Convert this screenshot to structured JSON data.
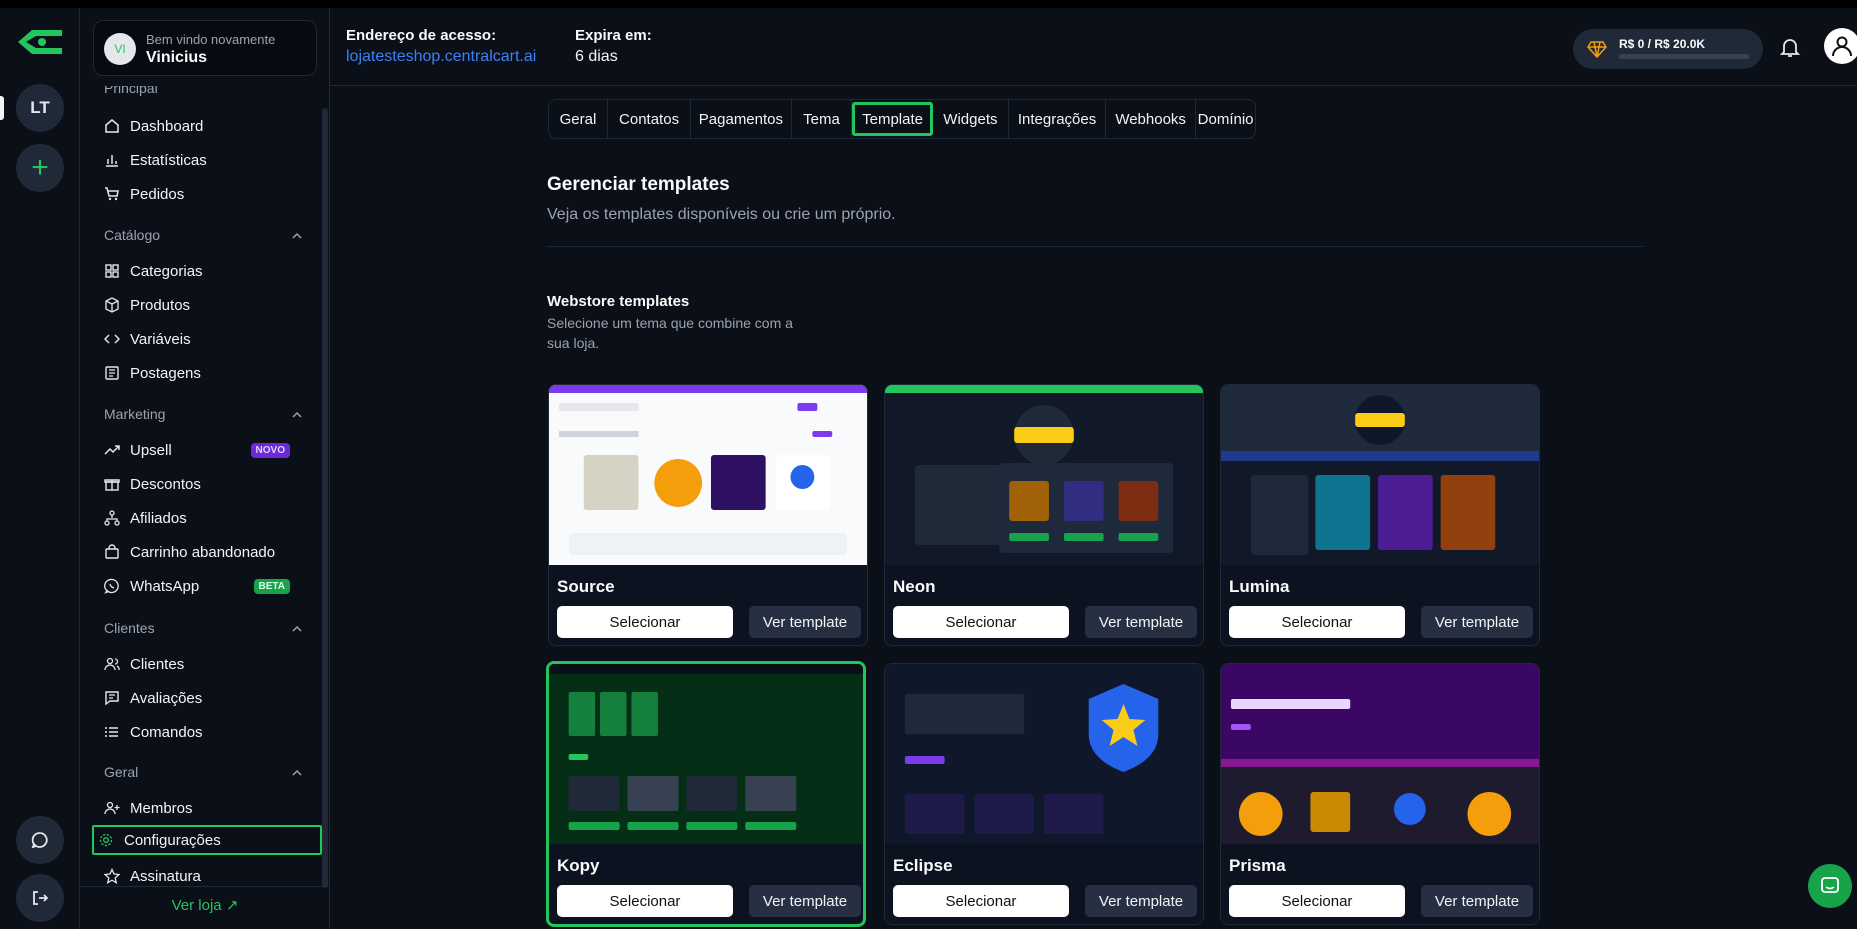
{
  "rail": {
    "store_initials": "LT"
  },
  "user": {
    "initials": "VI",
    "greeting": "Bem vindo novamente",
    "name": "Vinicius"
  },
  "header": {
    "address_label": "Endereço de acesso:",
    "address_value": "lojatesteshop.centralcart.ai",
    "expires_label": "Expira em:",
    "expires_value": "6 dias",
    "credit_text": "R$ 0 / R$ 20.0K",
    "credit_progress": 0
  },
  "sidebar": {
    "cut_group": "Principal",
    "main": [
      "Dashboard",
      "Estatísticas",
      "Pedidos"
    ],
    "catalog": {
      "title": "Catálogo",
      "items": [
        "Categorias",
        "Produtos",
        "Variáveis",
        "Postagens"
      ]
    },
    "marketing": {
      "title": "Marketing",
      "items": [
        "Upsell",
        "Descontos",
        "Afiliados",
        "Carrinho abandonado",
        "WhatsApp"
      ],
      "badge_novo": "NOVO",
      "badge_beta": "BETA"
    },
    "clients": {
      "title": "Clientes",
      "items": [
        "Clientes",
        "Avaliações",
        "Comandos"
      ]
    },
    "general": {
      "title": "Geral",
      "items": [
        "Membros",
        "Configurações",
        "Assinatura"
      ]
    },
    "view_store": "Ver loja"
  },
  "tabs": [
    "Geral",
    "Contatos",
    "Pagamentos",
    "Tema",
    "Template",
    "Widgets",
    "Integrações",
    "Webhooks",
    "Domínio"
  ],
  "active_tab": "Template",
  "section": {
    "title": "Gerenciar templates",
    "subtitle": "Veja os templates disponíveis ou crie um próprio.",
    "webstore_title": "Webstore templates",
    "webstore_subtitle": "Selecione um tema que combine com a sua loja."
  },
  "buttons": {
    "select": "Selecionar",
    "view": "Ver template"
  },
  "templates": [
    {
      "name": "Source",
      "selected": false
    },
    {
      "name": "Neon",
      "selected": false
    },
    {
      "name": "Lumina",
      "selected": false
    },
    {
      "name": "Kopy",
      "selected": true
    },
    {
      "name": "Eclipse",
      "selected": false
    },
    {
      "name": "Prisma",
      "selected": false
    }
  ],
  "colors": {
    "accent": "#22c55e",
    "background": "#0b0f17",
    "purple": "#7c3aed"
  }
}
